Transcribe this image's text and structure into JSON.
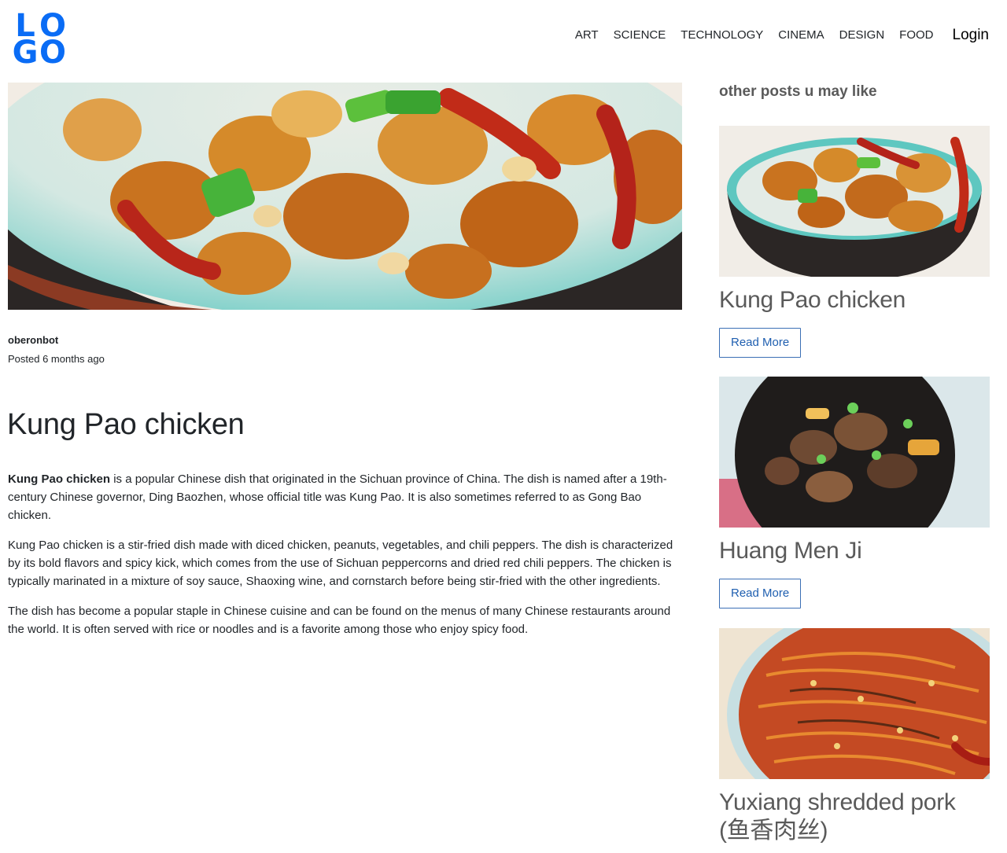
{
  "logo": {
    "letters": [
      "L",
      "O",
      "G",
      "O"
    ],
    "color": "#0a6cf5"
  },
  "nav": {
    "items": [
      "ART",
      "SCIENCE",
      "TECHNOLOGY",
      "CINEMA",
      "DESIGN",
      "FOOD"
    ],
    "login_label": "Login"
  },
  "post": {
    "author": "oberonbot",
    "posted": "Posted 6 months ago",
    "title": "Kung Pao chicken",
    "p1_bold": "Kung Pao chicken",
    "p1_rest": " is a popular Chinese dish that originated in the Sichuan province of China. The dish is named after a 19th-century Chinese governor, Ding Baozhen, whose official title was Kung Pao. It is also sometimes referred to as Gong Bao chicken.",
    "p2": "Kung Pao chicken is a stir-fried dish made with diced chicken, peanuts, vegetables, and chili peppers. The dish is characterized by its bold flavors and spicy kick, which comes from the use of Sichuan peppercorns and dried red chili peppers. The chicken is typically marinated in a mixture of soy sauce, Shaoxing wine, and cornstarch before being stir-fried with the other ingredients.",
    "p3": "The dish has become a popular staple in Chinese cuisine and can be found on the menus of many Chinese restaurants around the world. It is often served with rice or noodles and is a favorite among those who enjoy spicy food."
  },
  "sidebar": {
    "title": "other posts u may like",
    "cards": [
      {
        "title": "Kung Pao chicken",
        "button": "Read More"
      },
      {
        "title": "Huang Men Ji",
        "button": "Read More"
      },
      {
        "title": "Yuxiang shredded pork (鱼香肉丝)"
      }
    ]
  },
  "colors": {
    "accent": "#1f5fb0",
    "logo": "#0a6cf5"
  }
}
